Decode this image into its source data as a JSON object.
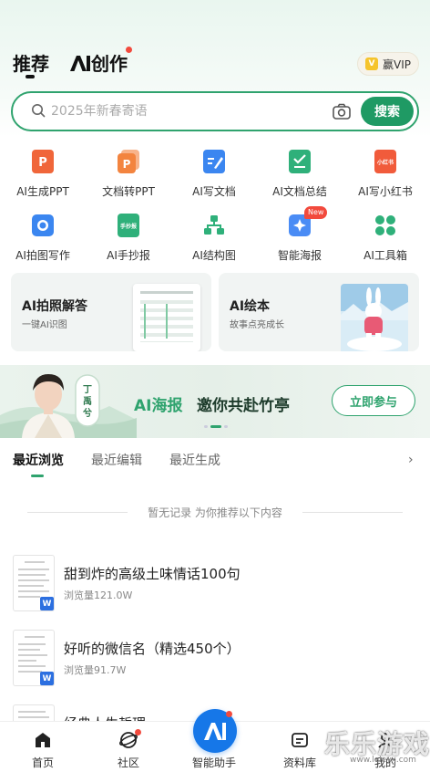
{
  "header": {
    "tab_recommend": "推荐",
    "tab_ai_create": "创作",
    "vip_icon": "V",
    "vip_label": "赢VIP"
  },
  "search": {
    "placeholder": "2025年新春寄语",
    "button": "搜索"
  },
  "tools": [
    {
      "label": "AI生成PPT",
      "icon": "ppt-icon",
      "color": "#f0663a"
    },
    {
      "label": "文档转PPT",
      "icon": "doc-to-ppt-icon",
      "color": "#f3843f"
    },
    {
      "label": "AI写文档",
      "icon": "write-doc-icon",
      "color": "#3b86f0"
    },
    {
      "label": "AI文档总结",
      "icon": "summary-icon",
      "color": "#2fb07a"
    },
    {
      "label": "AI写小红书",
      "icon": "xiaohongshu-icon",
      "color": "#f15b3b",
      "icon_text": "小红书"
    },
    {
      "label": "AI拍图写作",
      "icon": "camera-write-icon",
      "color": "#3b86f0"
    },
    {
      "label": "AI手抄报",
      "icon": "handcopy-icon",
      "color": "#2fb07a",
      "icon_text": "手抄报"
    },
    {
      "label": "AI结构图",
      "icon": "structure-icon",
      "color": "#2fb07a"
    },
    {
      "label": "智能海报",
      "icon": "poster-icon",
      "color": "#3b86f0",
      "badge": "New"
    },
    {
      "label": "AI工具箱",
      "icon": "toolbox-icon",
      "color": "#2fb07a"
    }
  ],
  "cards": [
    {
      "title": "AI拍照解答",
      "subtitle": "一键AI识图"
    },
    {
      "title": "AI绘本",
      "subtitle": "故事点亮成长"
    }
  ],
  "banner": {
    "title": "AI海报",
    "subtitle": "邀你共赴竹亭",
    "button": "立即参与",
    "stamp": "丁禹兮"
  },
  "recent_tabs": [
    "最近浏览",
    "最近编辑",
    "最近生成"
  ],
  "empty_text": "暂无记录 为你推荐以下内容",
  "docs": [
    {
      "title": "甜到炸的高级土味情话100句",
      "meta": "浏览量121.0W",
      "badge": "W"
    },
    {
      "title": "好听的微信名（精选450个）",
      "meta": "浏览量91.7W",
      "badge": "W"
    },
    {
      "title": "经典人生哲理",
      "meta": "",
      "badge": ""
    }
  ],
  "bottom_nav": [
    {
      "label": "首页",
      "icon": "home-icon"
    },
    {
      "label": "社区",
      "icon": "community-icon"
    },
    {
      "label": "智能助手",
      "icon": "assistant-icon"
    },
    {
      "label": "资料库",
      "icon": "library-icon"
    },
    {
      "label": "我的",
      "icon": "profile-icon"
    }
  ],
  "watermark": {
    "text": "乐乐游戏",
    "url": "www.leleyx.com"
  },
  "colors": {
    "accent": "#1f9a64",
    "brand_blue": "#1677e8",
    "badge_red": "#f24a3d"
  }
}
